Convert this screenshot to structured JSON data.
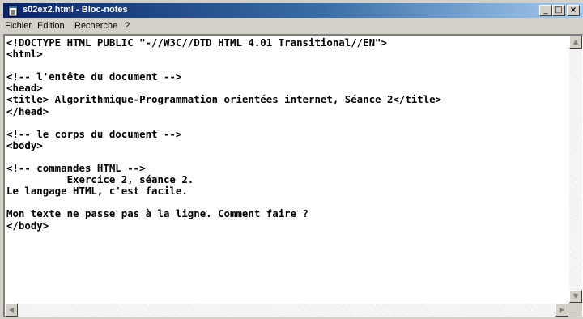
{
  "window": {
    "title": "s02ex2.html - Bloc-notes",
    "icon": "notepad-icon",
    "controls": {
      "minimize": "_",
      "maximize": "□",
      "close": "×"
    }
  },
  "menu": [
    {
      "label": "Fichier"
    },
    {
      "label": "Edition"
    },
    {
      "label": "Recherche"
    },
    {
      "label": "?"
    }
  ],
  "editor": {
    "lines": [
      "<!DOCTYPE HTML PUBLIC \"-//W3C//DTD HTML 4.01 Transitional//EN\">",
      "<html>",
      "",
      "<!-- l'entête du document -->",
      "<head>",
      "<title> Algorithmique-Programmation orientées internet, Séance 2</title>",
      "</head>",
      "",
      "<!-- le corps du document -->",
      "<body>",
      "",
      "<!-- commandes HTML -->",
      "          Exercice 2, séance 2.",
      "Le langage HTML, c'est facile.",
      "",
      "Mon texte ne passe pas à la ligne. Comment faire ?",
      "</body>"
    ]
  },
  "scrollbars": {
    "up": "▲",
    "down": "▼",
    "left": "◀",
    "right": "▶"
  }
}
